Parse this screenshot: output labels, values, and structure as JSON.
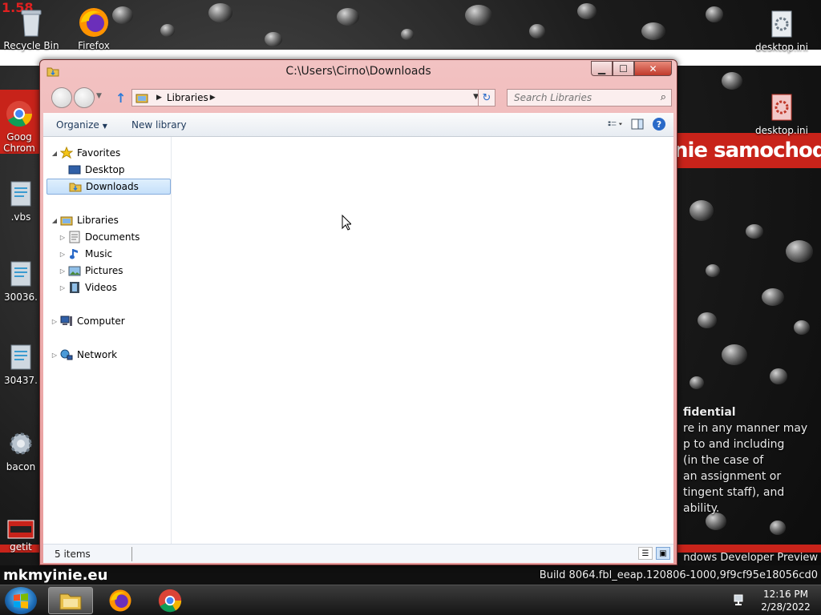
{
  "desktop": {
    "badge_number": "1.58",
    "icons": [
      {
        "name": "recycle-bin",
        "label": "Recycle Bin"
      },
      {
        "name": "firefox",
        "label": "Firefox"
      },
      {
        "name": "chrome",
        "label": "Goog Chrom"
      },
      {
        "name": "vbs",
        "label": ".vbs"
      },
      {
        "name": "file-30036",
        "label": "30036."
      },
      {
        "name": "file-30437",
        "label": "30437."
      },
      {
        "name": "bacon",
        "label": "bacon"
      },
      {
        "name": "getit",
        "label": "getit"
      },
      {
        "name": "desktop-ini-1",
        "label": "desktop.ini"
      },
      {
        "name": "desktop-ini-2",
        "label": "desktop.ini"
      }
    ],
    "banner_text": "nie samochodow",
    "confidential_lines": [
      "fidential",
      "re in any manner may",
      "p to and including",
      "(in the case of",
      "an assignment or",
      "tingent staff), and",
      "ability."
    ],
    "build_lines": [
      "ndows Developer Preview",
      "Build 8064.fbl_eeap.120806-1000,9f9cf95e18056cd0"
    ],
    "watermark": "mkmyinie.eu"
  },
  "window": {
    "title": "C:\\Users\\Cirno\\Downloads",
    "controls": {
      "minimize": "▁",
      "maximize": "☐",
      "close": "✕"
    },
    "address": {
      "crumb": "Libraries"
    },
    "search": {
      "placeholder": "Search Libraries"
    },
    "commands": {
      "organize": "Organize",
      "new_library": "New library"
    },
    "nav": {
      "favorites": {
        "label": "Favorites",
        "items": [
          {
            "label": "Desktop"
          },
          {
            "label": "Downloads"
          }
        ]
      },
      "libraries": {
        "label": "Libraries",
        "items": [
          {
            "label": "Documents"
          },
          {
            "label": "Music"
          },
          {
            "label": "Pictures"
          },
          {
            "label": "Videos"
          }
        ]
      },
      "computer": {
        "label": "Computer"
      },
      "network": {
        "label": "Network"
      }
    },
    "status": {
      "count": "5 items"
    }
  },
  "taskbar": {
    "clock": {
      "time": "12:16 PM",
      "date": "2/28/2022"
    }
  },
  "colors": {
    "accent_red": "#c8231a",
    "window_frame": "#e89a9a",
    "selection": "#c5e0fa"
  }
}
